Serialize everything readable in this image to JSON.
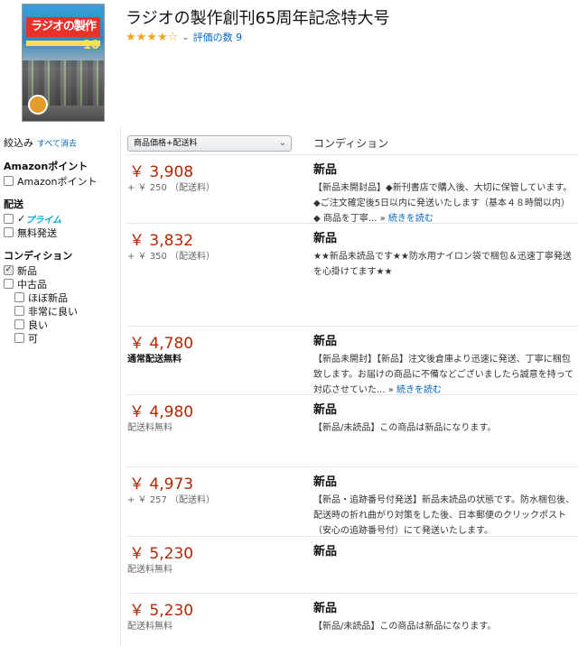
{
  "product": {
    "title": "ラジオの製作創刊65周年記念特大号",
    "cover_title": "ラジオの製作",
    "cover_issue": "10",
    "stars": "★★★★☆",
    "rating_label": "評価の数 9"
  },
  "sidebar": {
    "narrow_label": "絞込み",
    "clear_all": "すべて消去",
    "groups": [
      {
        "title": "Amazonポイント",
        "items": [
          {
            "label": "Amazonポイント",
            "checked": false
          }
        ]
      },
      {
        "title": "配送",
        "items": [
          {
            "label": "プライム",
            "checked": false,
            "prime": true
          },
          {
            "label": "無料発送",
            "checked": false
          }
        ]
      },
      {
        "title": "コンディション",
        "items": [
          {
            "label": "新品",
            "checked": true
          },
          {
            "label": "中古品",
            "checked": false
          },
          {
            "label": "ほぼ新品",
            "checked": false,
            "indent": true
          },
          {
            "label": "非常に良い",
            "checked": false,
            "indent": true
          },
          {
            "label": "良い",
            "checked": false,
            "indent": true
          },
          {
            "label": "可",
            "checked": false,
            "indent": true
          }
        ]
      }
    ]
  },
  "list": {
    "sort_label": "商品価格+配送料",
    "condition_header": "コンディション",
    "offers": [
      {
        "price": "￥ 3,908",
        "shipping": "+ ￥ 250 （配送料）",
        "condition": "新品",
        "desc": "【新品未開封品】◆新刊書店で購入後、大切に保管しています。◆ご注文確定後5日以内に発送いたします（基本４８時間以内）◆ 商品を丁寧... » ",
        "read_more": "続きを読む"
      },
      {
        "price": "￥ 3,832",
        "shipping": "+ ￥ 350 （配送料）",
        "condition": "新品",
        "desc": "★★新品未読品です★★防水用ナイロン袋で梱包＆迅速丁寧発送を心掛けてます★★",
        "read_more": ""
      },
      {
        "price": "￥ 4,780",
        "shipping": "通常配送無料",
        "shipping_bold": true,
        "condition": "新品",
        "desc": "【新品未開封】【新品】注文後倉庫より迅速に発送、丁寧に梱包致します。お届けの商品に不備などございましたら誠意を持って対応させていた... » ",
        "read_more": "続きを読む"
      },
      {
        "price": "￥ 4,980",
        "shipping": "配送料無料",
        "condition": "新品",
        "desc": "【新品/未読品】この商品は新品になります。",
        "read_more": ""
      },
      {
        "price": "￥ 4,973",
        "shipping": "+ ￥ 257 （配送料）",
        "condition": "新品",
        "desc": "【新品・追跡番号付発送】新品未読品の状態です。防水梱包後、配送時の折れ曲がり対策をした後、日本郵便のクリックポスト（安心の追跡番号付）にて発送いたします。",
        "read_more": ""
      },
      {
        "price": "￥ 5,230",
        "shipping": "配送料無料",
        "condition": "新品",
        "desc": "",
        "read_more": ""
      },
      {
        "price": "￥ 5,230",
        "shipping": "配送料無料",
        "condition": "新品",
        "desc": "【新品/未読品】この商品は新品になります。",
        "read_more": ""
      }
    ]
  },
  "colors": {
    "price": "#b12704",
    "link": "#0066c0",
    "star": "#f1a51c",
    "prime": "#00a8e1"
  }
}
